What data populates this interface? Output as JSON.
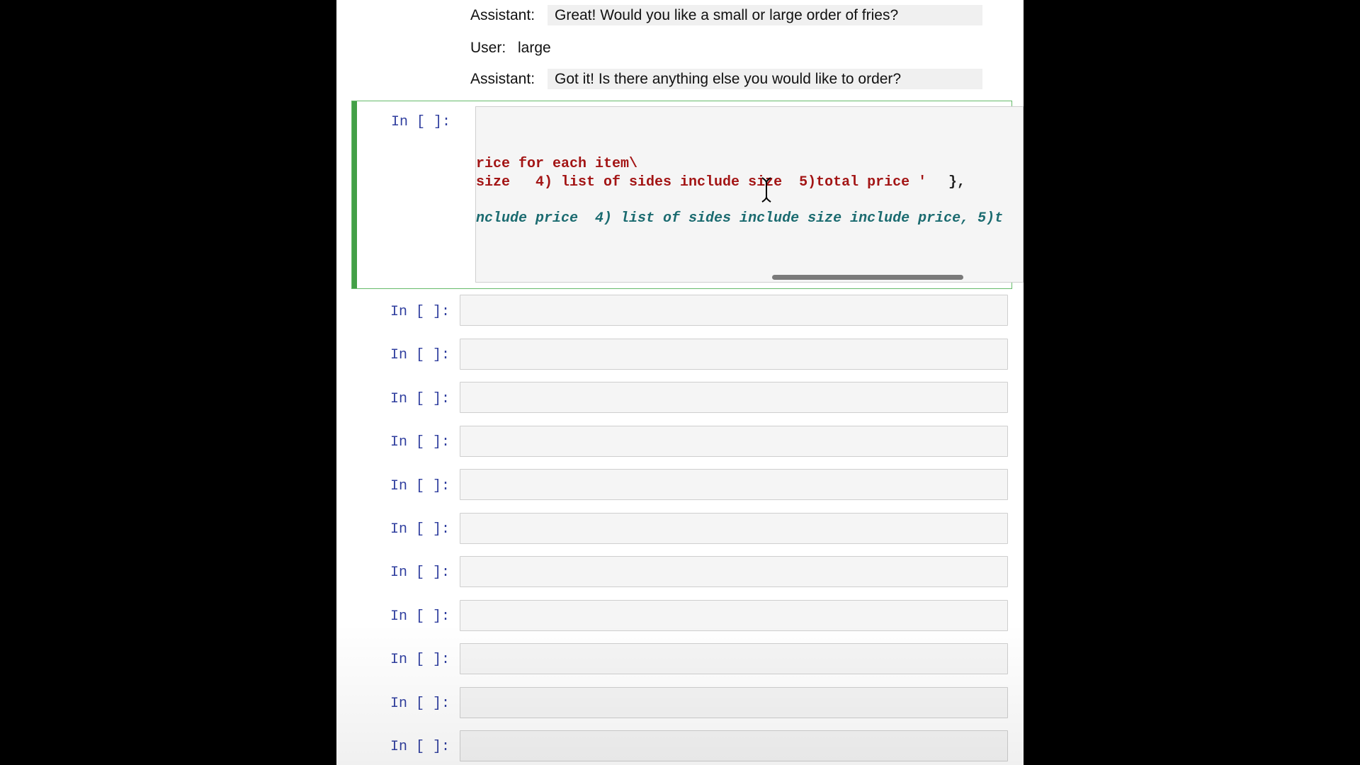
{
  "chat": [
    {
      "role": "Assistant:",
      "message": "Great! Would you like a small or large order of fries?"
    },
    {
      "role": "User:",
      "message": "large"
    },
    {
      "role": "Assistant:",
      "message": "Got it! Is there anything else you would like to order?"
    }
  ],
  "active_cell": {
    "prompt": "In [ ]:",
    "code_lines": [
      "rice for each item\\",
      "size   4) list of sides include size  5)total price '",
      "},",
      "nclude price  4) list of sides include size include price, 5)t"
    ]
  },
  "empty_cells": [
    "In [ ]:",
    "In [ ]:",
    "In [ ]:",
    "In [ ]:",
    "In [ ]:",
    "In [ ]:",
    "In [ ]:",
    "In [ ]:",
    "In [ ]:",
    "In [ ]:",
    "In [ ]:"
  ],
  "colors": {
    "prompt": "#303f9f",
    "string": "#a31515",
    "comment_italic": "#1b6b70",
    "active_border": "#43a047"
  },
  "icons": [
    "text-cursor-icon"
  ]
}
